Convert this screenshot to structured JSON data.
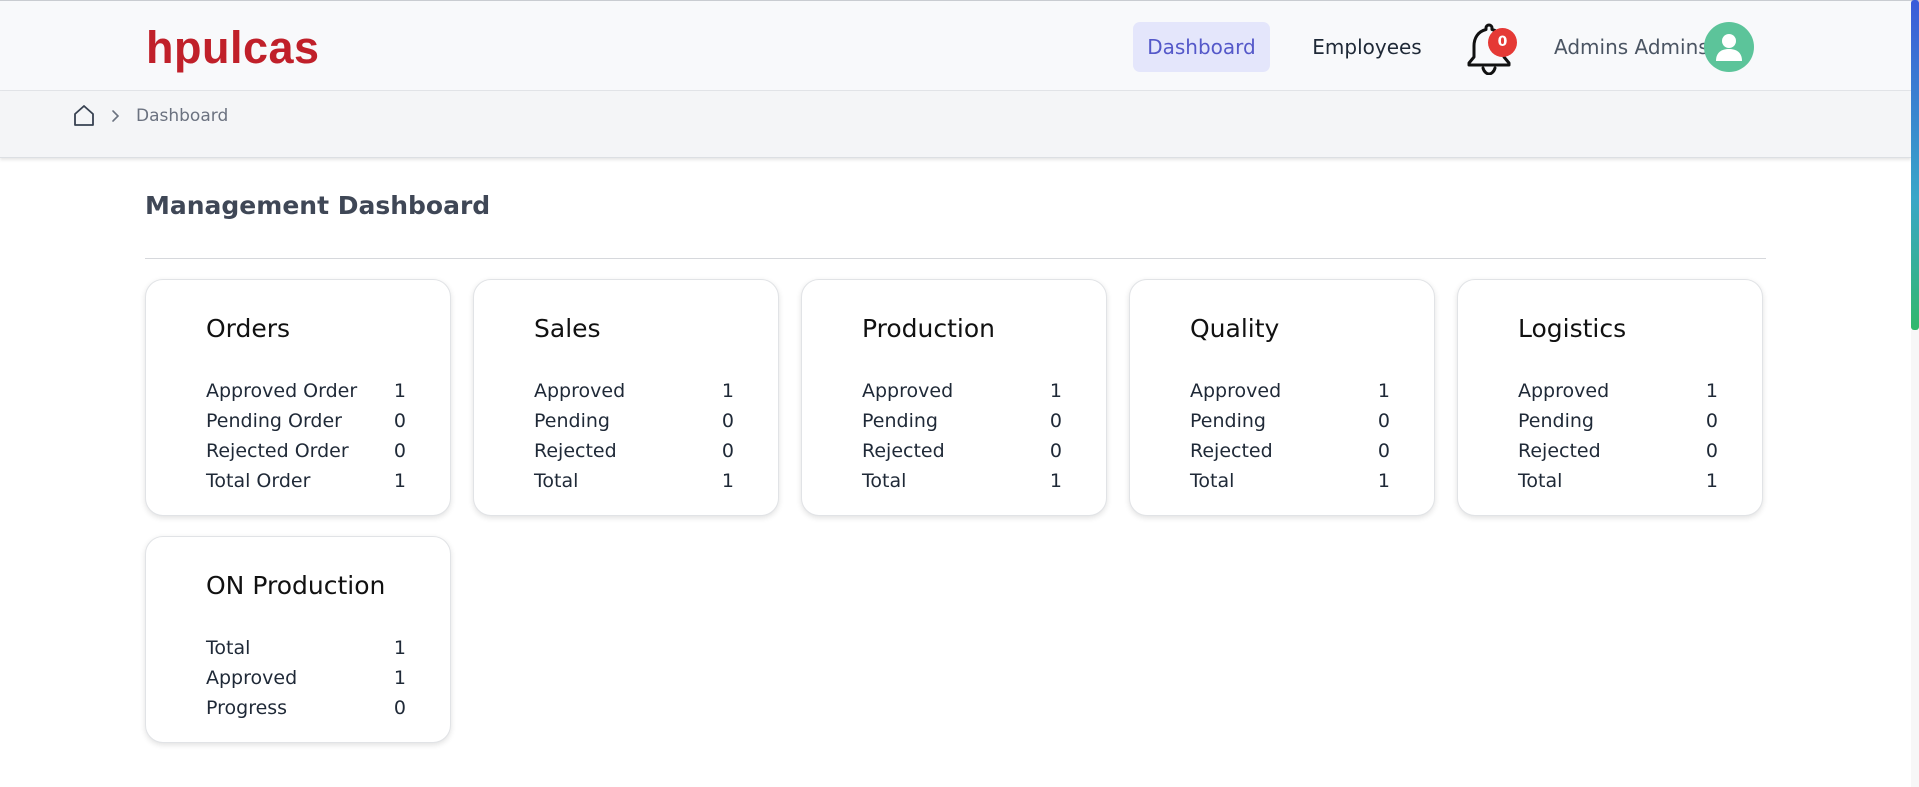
{
  "header": {
    "logo": "hpulcas",
    "nav": [
      {
        "label": "Dashboard",
        "active": true
      },
      {
        "label": "Employees",
        "active": false
      }
    ],
    "notification_count": "0",
    "user_name": "Admins Admins"
  },
  "breadcrumb": {
    "items": [
      "Dashboard"
    ]
  },
  "page": {
    "title": "Management Dashboard"
  },
  "cards": [
    {
      "title": "Orders",
      "rows": [
        {
          "label": "Approved Order",
          "value": "1"
        },
        {
          "label": "Pending Order",
          "value": "0"
        },
        {
          "label": "Rejected Order",
          "value": "0"
        },
        {
          "label": "Total Order",
          "value": "1"
        }
      ]
    },
    {
      "title": "Sales",
      "rows": [
        {
          "label": "Approved",
          "value": "1"
        },
        {
          "label": "Pending",
          "value": "0"
        },
        {
          "label": "Rejected",
          "value": "0"
        },
        {
          "label": "Total",
          "value": "1"
        }
      ]
    },
    {
      "title": "Production",
      "rows": [
        {
          "label": "Approved",
          "value": "1"
        },
        {
          "label": "Pending",
          "value": "0"
        },
        {
          "label": "Rejected",
          "value": "0"
        },
        {
          "label": "Total",
          "value": "1"
        }
      ]
    },
    {
      "title": "Quality",
      "rows": [
        {
          "label": "Approved",
          "value": "1"
        },
        {
          "label": "Pending",
          "value": "0"
        },
        {
          "label": "Rejected",
          "value": "0"
        },
        {
          "label": "Total",
          "value": "1"
        }
      ]
    },
    {
      "title": "Logistics",
      "rows": [
        {
          "label": "Approved",
          "value": "1"
        },
        {
          "label": "Pending",
          "value": "0"
        },
        {
          "label": "Rejected",
          "value": "0"
        },
        {
          "label": "Total",
          "value": "1"
        }
      ]
    },
    {
      "title": "ON Production",
      "rows": [
        {
          "label": "Total",
          "value": "1"
        },
        {
          "label": "Approved",
          "value": "1"
        },
        {
          "label": "Progress",
          "value": "0"
        }
      ]
    }
  ],
  "colors": {
    "brand": "#c0202a",
    "nav_active_bg": "#e4e6fb",
    "nav_active_text": "#5458c9",
    "badge": "#e53935",
    "avatar": "#5cc49a"
  }
}
